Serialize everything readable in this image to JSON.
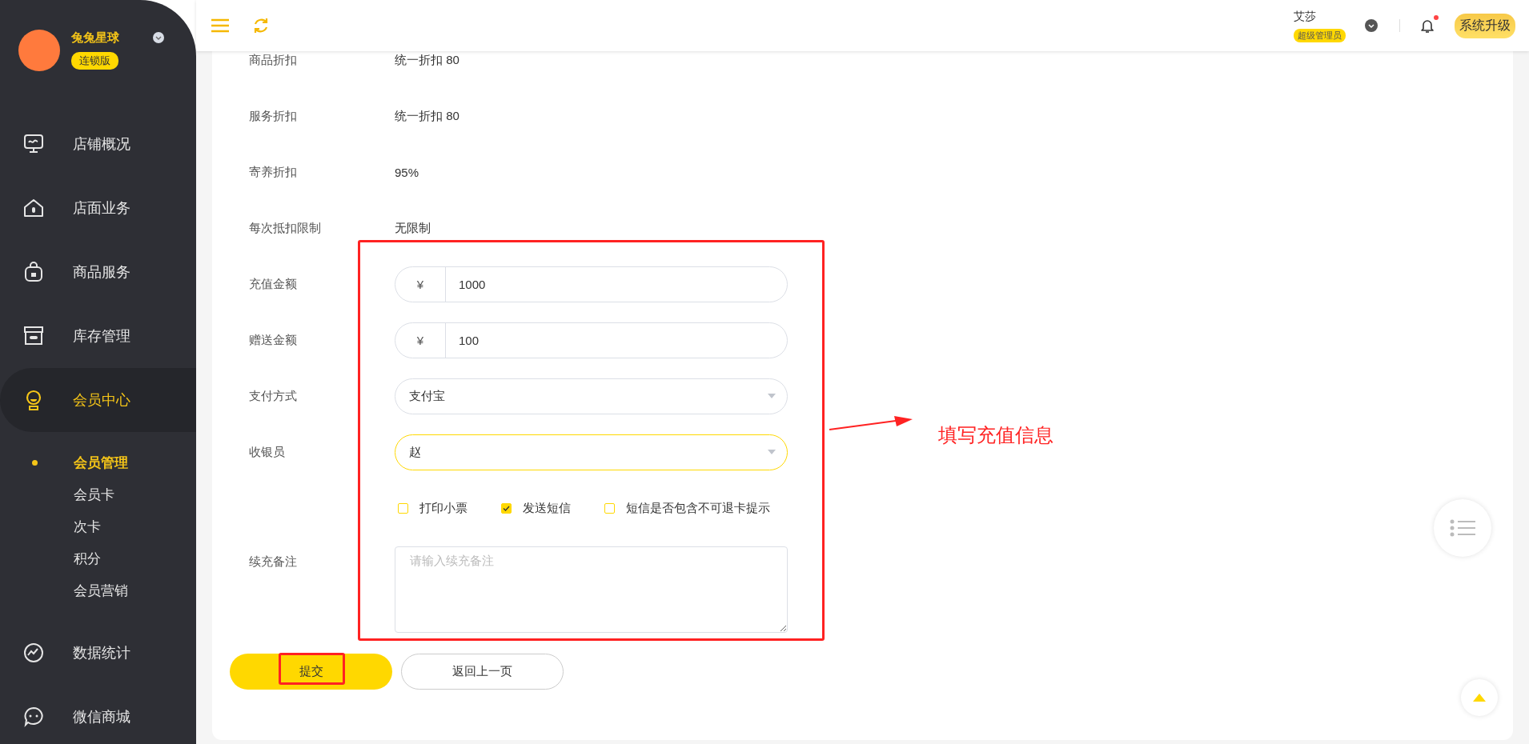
{
  "sidebar": {
    "brand": {
      "name": "兔兔星球",
      "edition": "连锁版"
    },
    "items": [
      {
        "label": "店铺概况",
        "selected": false
      },
      {
        "label": "店面业务",
        "selected": false
      },
      {
        "label": "商品服务",
        "selected": false
      },
      {
        "label": "库存管理",
        "selected": false
      },
      {
        "label": "会员中心",
        "selected": true,
        "children": [
          {
            "label": "会员管理",
            "selected": true
          },
          {
            "label": "会员卡",
            "selected": false
          },
          {
            "label": "次卡",
            "selected": false
          },
          {
            "label": "积分",
            "selected": false
          },
          {
            "label": "会员营销",
            "selected": false
          }
        ]
      },
      {
        "label": "数据统计",
        "selected": false
      },
      {
        "label": "微信商城",
        "selected": false
      }
    ]
  },
  "topbar": {
    "user": {
      "name": "艾莎",
      "role": "超级管理员"
    },
    "has_unread": true,
    "upgrade_button": "系统升级"
  },
  "form": {
    "rows": [
      {
        "kind": "info",
        "label": "商品折扣",
        "value": "统一折扣 80"
      },
      {
        "kind": "info",
        "label": "服务折扣",
        "value": "统一折扣 80"
      },
      {
        "kind": "info",
        "label": "寄养折扣",
        "value": "95%"
      },
      {
        "kind": "info",
        "label": "每次抵扣限制",
        "value": "无限制"
      },
      {
        "kind": "currency",
        "label": "充值金额",
        "prefix": "¥",
        "value": "1000"
      },
      {
        "kind": "currency",
        "label": "赠送金额",
        "prefix": "¥",
        "value": "100"
      },
      {
        "kind": "select",
        "label": "支付方式",
        "value": "支付宝",
        "focused": false
      },
      {
        "kind": "select",
        "label": "收银员",
        "value": "赵",
        "focused": true
      },
      {
        "kind": "checkboxes",
        "options": [
          {
            "label": "打印小票",
            "checked": false
          },
          {
            "label": "发送短信",
            "checked": true
          },
          {
            "label": "短信是否包含不可退卡提示",
            "checked": false
          }
        ]
      },
      {
        "kind": "textarea",
        "label": "续充备注",
        "placeholder": "请输入续充备注"
      }
    ],
    "buttons": {
      "submit": "提交",
      "back": "返回上一页"
    }
  },
  "annotation": {
    "text": "填写充值信息"
  }
}
